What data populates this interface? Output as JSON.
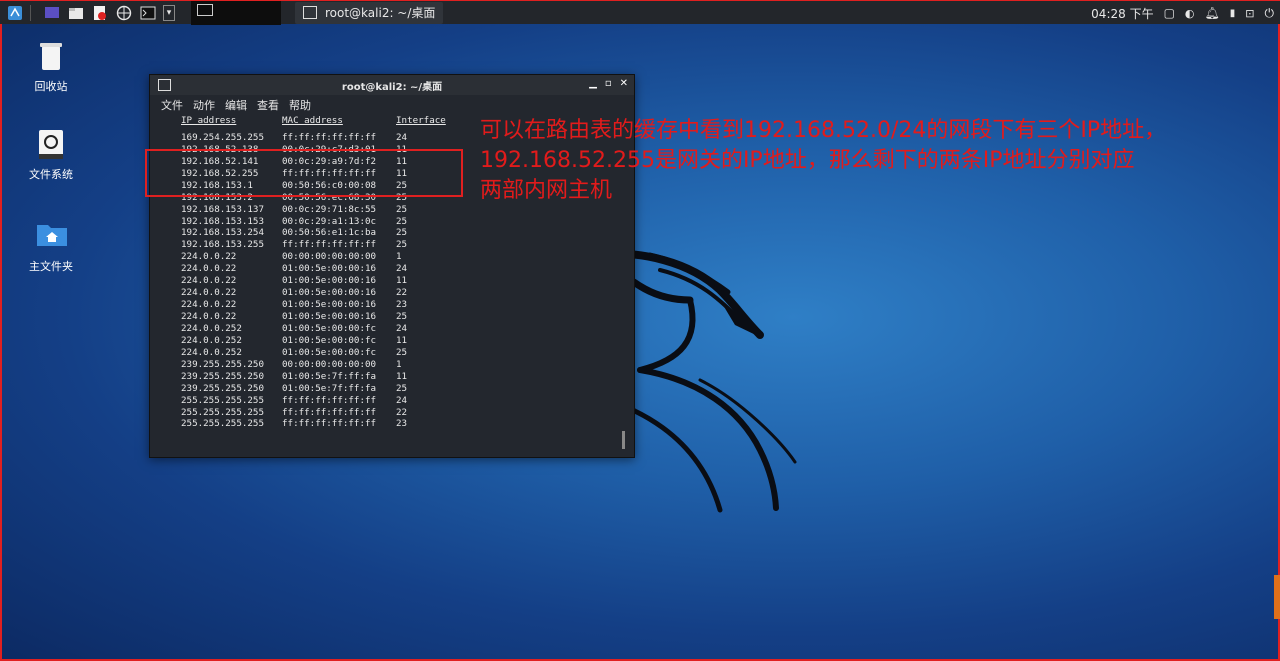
{
  "panel": {
    "task_title": "root@kali2: ~/桌面",
    "clock": "04:28 下午"
  },
  "desktop": {
    "icons": [
      {
        "label": "回收站",
        "icon": "trash-icon"
      },
      {
        "label": "文件系统",
        "icon": "drive-icon"
      },
      {
        "label": "主文件夹",
        "icon": "home-folder-icon"
      }
    ]
  },
  "terminal": {
    "title": "root@kali2: ~/桌面",
    "menu": [
      "文件",
      "动作",
      "编辑",
      "查看",
      "帮助"
    ],
    "headers": [
      "IP address",
      "MAC address",
      "Interface"
    ],
    "rows": [
      [
        "169.254.255.255",
        "ff:ff:ff:ff:ff:ff",
        "24"
      ],
      [
        "192.168.52.138",
        "00:0c:29:c7:d3:01",
        "11"
      ],
      [
        "192.168.52.141",
        "00:0c:29:a9:7d:f2",
        "11"
      ],
      [
        "192.168.52.255",
        "ff:ff:ff:ff:ff:ff",
        "11"
      ],
      [
        "192.168.153.1",
        "00:50:56:c0:00:08",
        "25"
      ],
      [
        "192.168.153.2",
        "00:50:56:ec:68:30",
        "25"
      ],
      [
        "192.168.153.137",
        "00:0c:29:71:8c:55",
        "25"
      ],
      [
        "192.168.153.153",
        "00:0c:29:a1:13:0c",
        "25"
      ],
      [
        "192.168.153.254",
        "00:50:56:e1:1c:ba",
        "25"
      ],
      [
        "192.168.153.255",
        "ff:ff:ff:ff:ff:ff",
        "25"
      ],
      [
        "224.0.0.22",
        "00:00:00:00:00:00",
        "1"
      ],
      [
        "224.0.0.22",
        "01:00:5e:00:00:16",
        "24"
      ],
      [
        "224.0.0.22",
        "01:00:5e:00:00:16",
        "11"
      ],
      [
        "224.0.0.22",
        "01:00:5e:00:00:16",
        "22"
      ],
      [
        "224.0.0.22",
        "01:00:5e:00:00:16",
        "23"
      ],
      [
        "224.0.0.22",
        "01:00:5e:00:00:16",
        "25"
      ],
      [
        "224.0.0.252",
        "01:00:5e:00:00:fc",
        "24"
      ],
      [
        "224.0.0.252",
        "01:00:5e:00:00:fc",
        "11"
      ],
      [
        "224.0.0.252",
        "01:00:5e:00:00:fc",
        "25"
      ],
      [
        "239.255.255.250",
        "00:00:00:00:00:00",
        "1"
      ],
      [
        "239.255.255.250",
        "01:00:5e:7f:ff:fa",
        "11"
      ],
      [
        "239.255.255.250",
        "01:00:5e:7f:ff:fa",
        "25"
      ],
      [
        "255.255.255.255",
        "ff:ff:ff:ff:ff:ff",
        "24"
      ],
      [
        "255.255.255.255",
        "ff:ff:ff:ff:ff:ff",
        "22"
      ],
      [
        "255.255.255.255",
        "ff:ff:ff:ff:ff:ff",
        "23"
      ]
    ]
  },
  "annotation": {
    "lines": [
      "可以在路由表的缓存中看到192.168.52.0/24的网段下有三个IP地址，",
      "192.168.52.255是网关的IP地址，那么剩下的两条IP地址分别对应",
      "两部内网主机"
    ],
    "color": "#e21b1b"
  }
}
